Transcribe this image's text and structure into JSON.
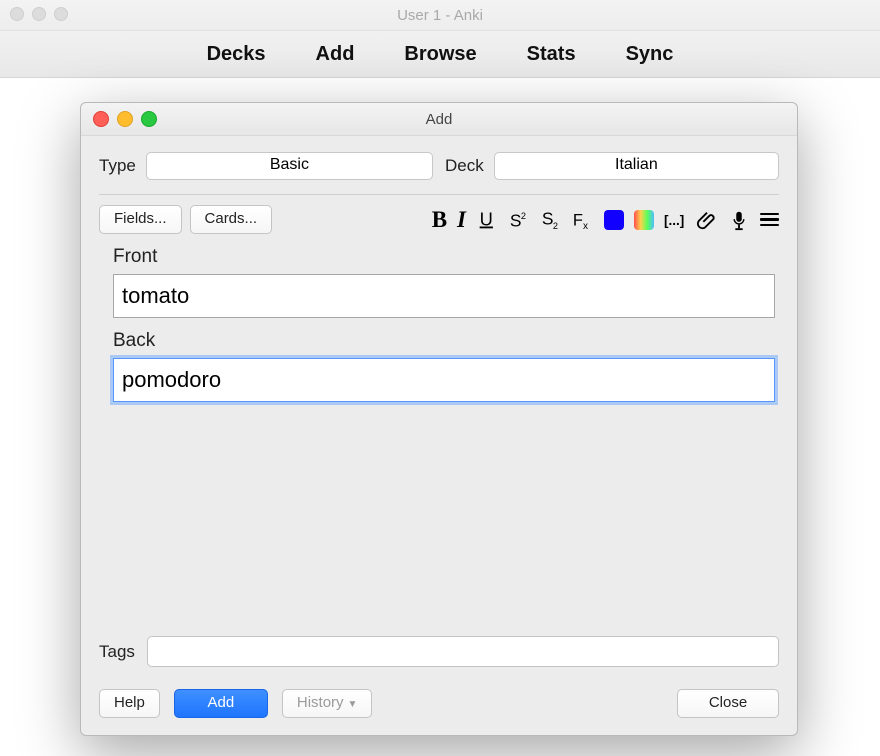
{
  "main_window": {
    "title": "User 1 - Anki",
    "toolbar": [
      "Decks",
      "Add",
      "Browse",
      "Stats",
      "Sync"
    ]
  },
  "modal": {
    "title": "Add",
    "type_label": "Type",
    "type_value": "Basic",
    "deck_label": "Deck",
    "deck_value": "Italian",
    "fields_btn": "Fields...",
    "cards_btn": "Cards...",
    "format_icons": {
      "bold": "B",
      "italic": "I",
      "underline": "U",
      "superscript": "S²",
      "subscript": "S₂",
      "clear": "Fx",
      "color": "color",
      "highlight": "rainbow",
      "cloze": "[...]",
      "attach": "clip",
      "record": "mic",
      "more": "menu"
    },
    "fields": {
      "front_label": "Front",
      "front_value": "tomato",
      "back_label": "Back",
      "back_value": "pomodoro"
    },
    "tags_label": "Tags",
    "tags_value": "",
    "buttons": {
      "help": "Help",
      "add": "Add",
      "history": "History",
      "close": "Close"
    }
  }
}
